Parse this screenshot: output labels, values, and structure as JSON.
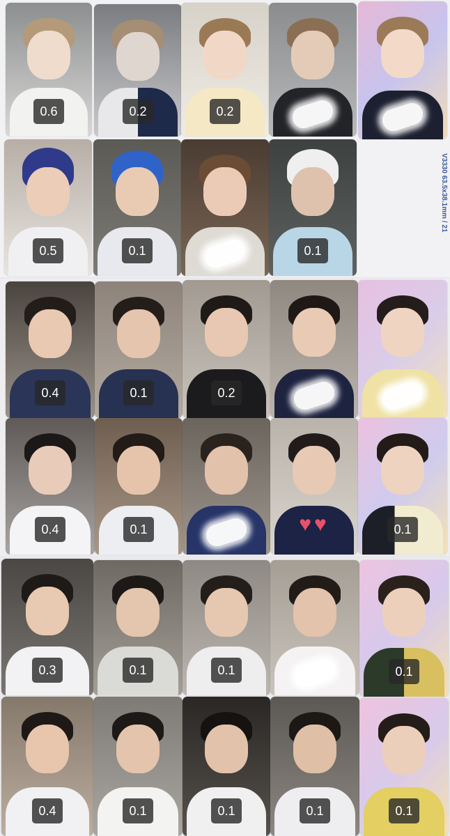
{
  "side_label": {
    "code": "V3330",
    "dimension": "63.5x38.1mm / 21"
  },
  "sheets": [
    {
      "rows": [
        [
          "0.6",
          "0.2",
          "0.2",
          "",
          ""
        ],
        [
          "0.5",
          "0.1",
          "",
          "0.1"
        ]
      ]
    },
    {
      "rows": [
        [
          "0.4",
          "0.1",
          "0.2",
          "",
          ""
        ],
        [
          "0.4",
          "0.1",
          "",
          "",
          "0.1"
        ]
      ]
    },
    {
      "rows": [
        [
          "0.3",
          "0.1",
          "0.1",
          "",
          "0.1"
        ],
        [
          "0.4",
          "0.1",
          "0.1",
          "0.1",
          "0.1"
        ]
      ]
    }
  ]
}
